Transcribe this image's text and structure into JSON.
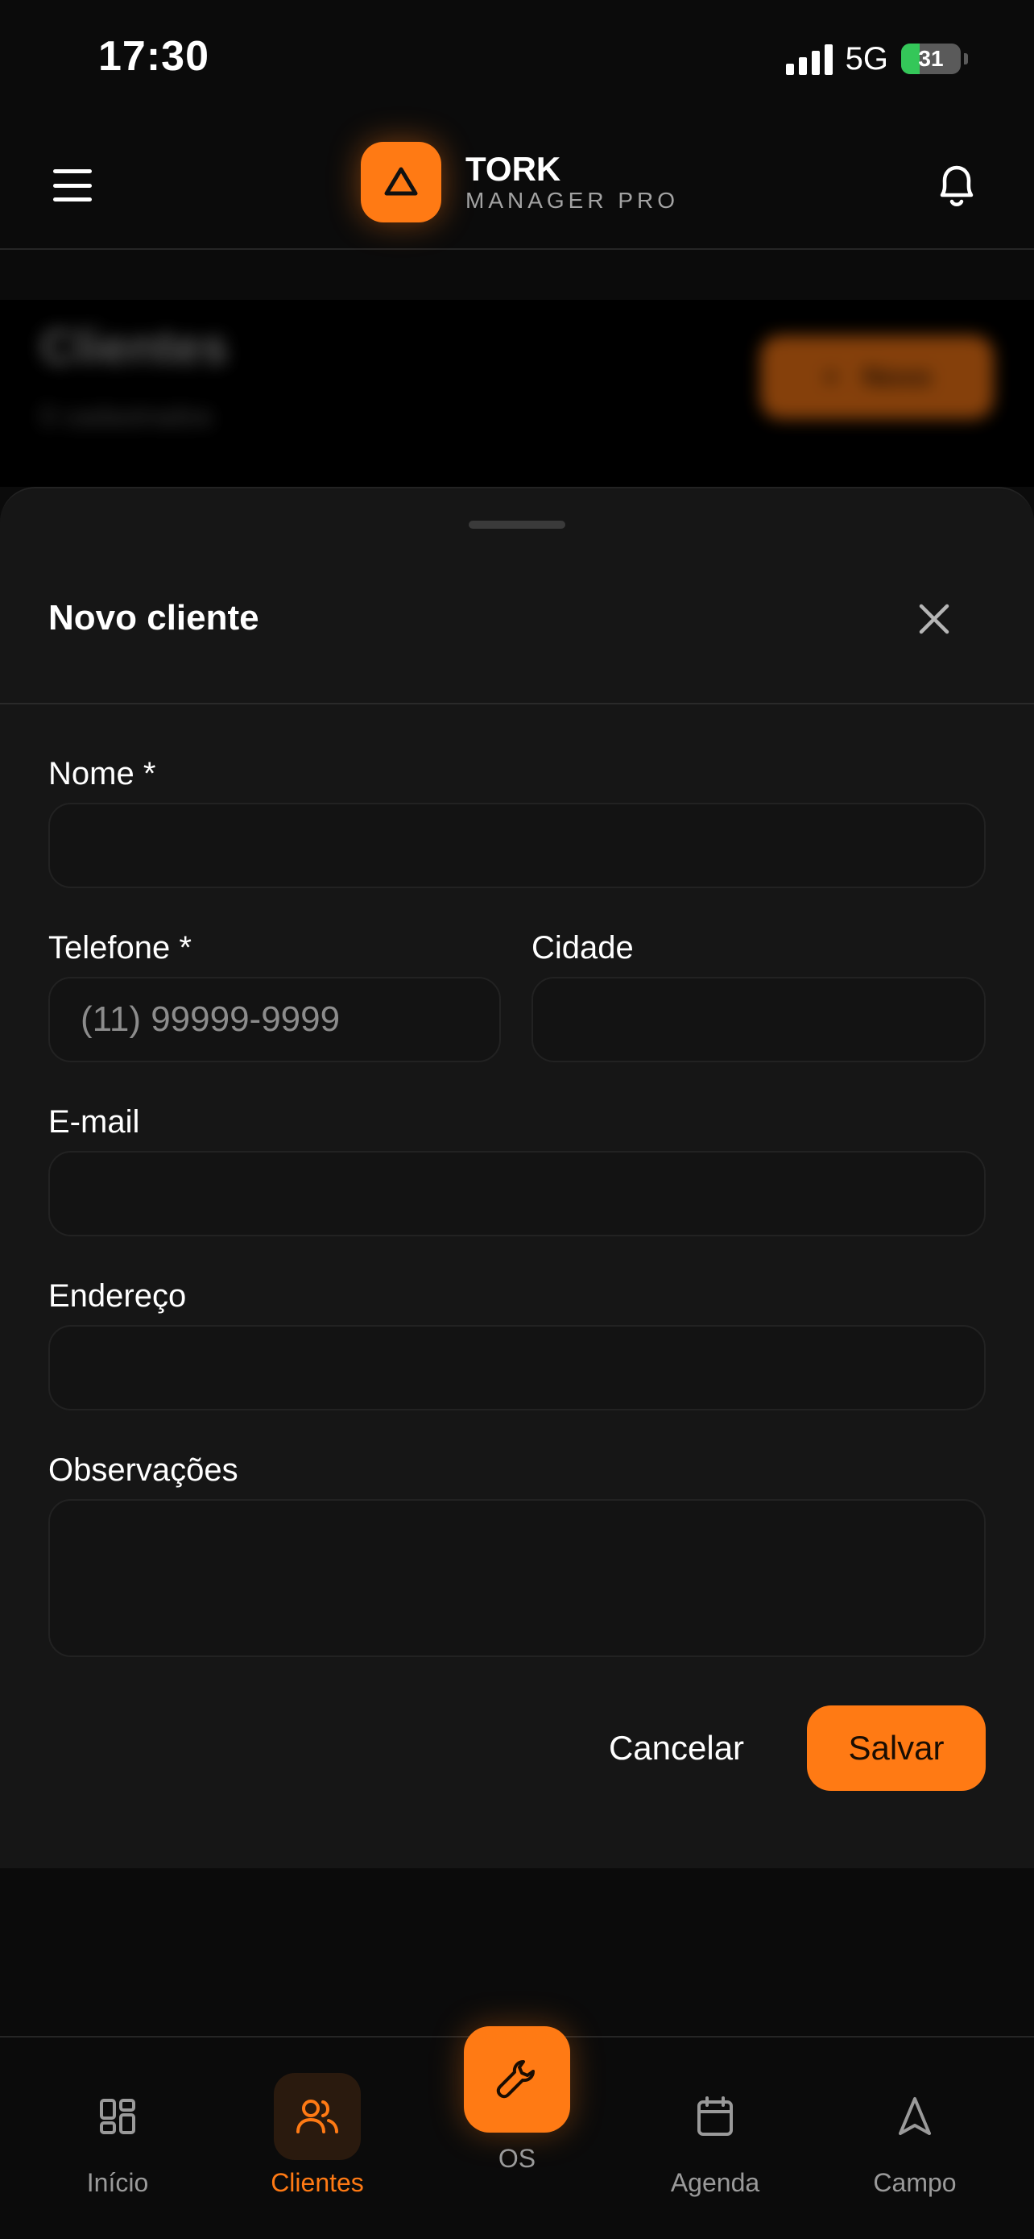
{
  "status_bar": {
    "time": "17:30",
    "network": "5G",
    "battery": "31",
    "battery_level": 0.31
  },
  "header": {
    "brand_title": "TORK",
    "brand_subtitle": "MANAGER PRO",
    "menu_icon": "hamburger-menu-icon",
    "notification_icon": "bell-icon"
  },
  "background_page": {
    "title": "Clientes",
    "count": "0 cadastrados",
    "new_button": "Novo"
  },
  "sheet": {
    "title": "Novo cliente",
    "close_icon": "close-icon",
    "fields": {
      "nome": {
        "label": "Nome *",
        "value": "",
        "placeholder": ""
      },
      "telefone": {
        "label": "Telefone *",
        "value": "",
        "placeholder": "(11) 99999-9999"
      },
      "cidade": {
        "label": "Cidade",
        "value": "",
        "placeholder": ""
      },
      "email": {
        "label": "E-mail",
        "value": "",
        "placeholder": ""
      },
      "endereco": {
        "label": "Endereço",
        "value": "",
        "placeholder": ""
      },
      "observacoes": {
        "label": "Observações",
        "value": "",
        "placeholder": ""
      }
    },
    "cancel_label": "Cancelar",
    "save_label": "Salvar"
  },
  "bottom_nav": {
    "items": [
      {
        "label": "Início",
        "icon": "grid-icon",
        "active": false
      },
      {
        "label": "Clientes",
        "icon": "users-icon",
        "active": true
      },
      {
        "label": "OS",
        "icon": "wrench-icon",
        "active": false
      },
      {
        "label": "Agenda",
        "icon": "calendar-icon",
        "active": false
      },
      {
        "label": "Campo",
        "icon": "navigation-arrow-icon",
        "active": false
      }
    ]
  },
  "colors": {
    "accent": "#ff7a14",
    "background": "#0b0b0b",
    "sheet": "#161616",
    "battery": "#34c759"
  }
}
